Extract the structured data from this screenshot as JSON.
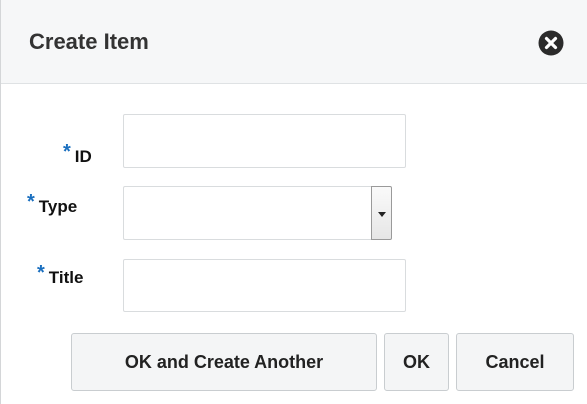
{
  "dialog": {
    "title": "Create Item",
    "close_icon": "close-icon"
  },
  "form": {
    "required_marker": "*",
    "id": {
      "label": "ID",
      "value": ""
    },
    "type": {
      "label": "Type",
      "selected": ""
    },
    "title": {
      "label": "Title",
      "value": ""
    }
  },
  "buttons": {
    "ok_and_create_another": "OK and Create Another",
    "ok": "OK",
    "cancel": "Cancel"
  },
  "colors": {
    "required_marker": "#1a6fbf",
    "header_background": "#f6f7f8"
  }
}
